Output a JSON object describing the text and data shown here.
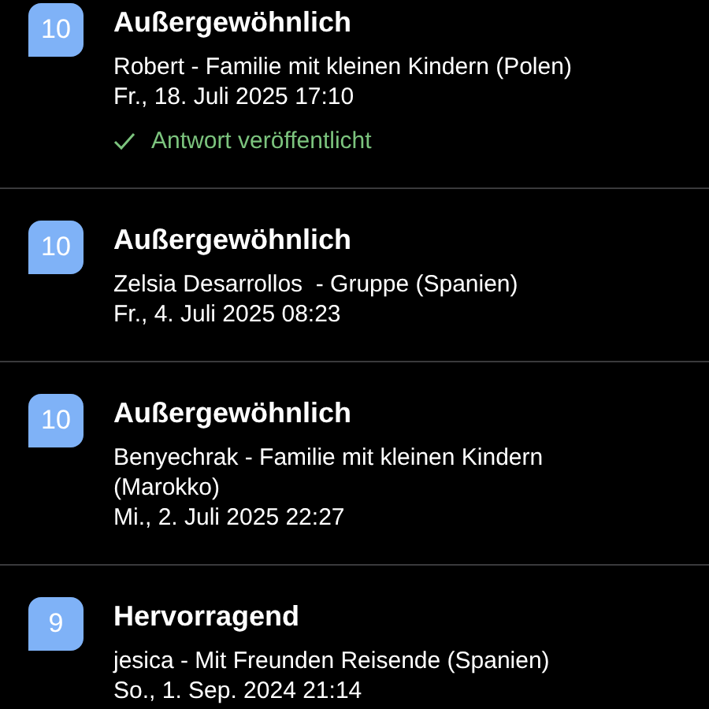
{
  "reviews": [
    {
      "score": "10",
      "rating": "Außergewöhnlich",
      "guest": "Robert - Familie mit kleinen Kindern (Polen)",
      "date": "Fr., 18. Juli 2025 17:10",
      "reply_status": "Antwort veröffentlicht"
    },
    {
      "score": "10",
      "rating": "Außergewöhnlich",
      "guest": "Zelsia Desarrollos  - Gruppe (Spanien)",
      "date": "Fr., 4. Juli 2025 08:23"
    },
    {
      "score": "10",
      "rating": "Außergewöhnlich",
      "guest": "Benyechrak - Familie mit kleinen Kindern (Marokko)",
      "date": "Mi., 2. Juli 2025 22:27"
    },
    {
      "score": "9",
      "rating": "Hervorragend",
      "guest": "jesica - Mit Freunden Reisende (Spanien)",
      "date": "So., 1. Sep. 2024 21:14"
    }
  ]
}
